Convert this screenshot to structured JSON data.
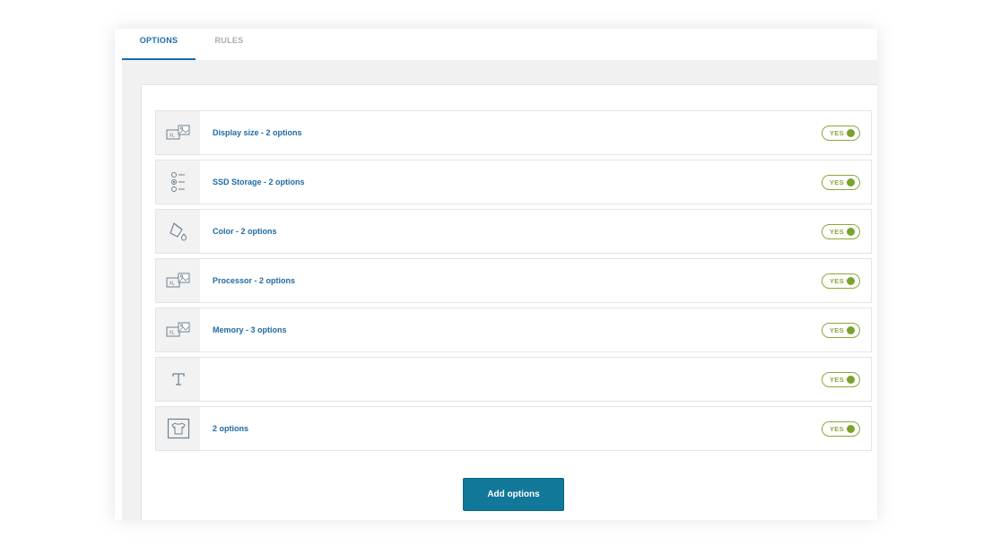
{
  "tabs": [
    {
      "label": "OPTIONS",
      "active": true
    },
    {
      "label": "RULES",
      "active": false
    }
  ],
  "options": [
    {
      "icon": "image-size-icon",
      "label": "Display size - 2 options",
      "toggle": "YES"
    },
    {
      "icon": "radio-list-icon",
      "label": "SSD Storage - 2 options",
      "toggle": "YES"
    },
    {
      "icon": "paint-bucket-icon",
      "label": "Color - 2 options",
      "toggle": "YES"
    },
    {
      "icon": "image-size-icon",
      "label": "Processor - 2 options",
      "toggle": "YES"
    },
    {
      "icon": "image-size-icon",
      "label": "Memory - 3 options",
      "toggle": "YES"
    },
    {
      "icon": "text-icon",
      "label": "",
      "toggle": "YES"
    },
    {
      "icon": "tshirt-icon",
      "label": "2 options",
      "toggle": "YES"
    }
  ],
  "add_button_label": "Add options",
  "colors": {
    "accent": "#1e6aa5",
    "toggle_green": "#8ba83a",
    "button_teal": "#12789a"
  }
}
